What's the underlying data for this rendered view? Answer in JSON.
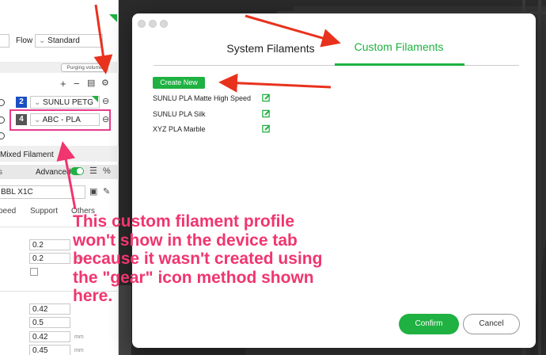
{
  "left_panel": {
    "flow_label": "Flow",
    "flow_value": "Standard",
    "purging_button": "Purging volume",
    "filaments": [
      {
        "index": "2",
        "name": "SUNLU PETG",
        "swatch": "#1a4fc4"
      },
      {
        "index": "4",
        "name": "ABC - PLA",
        "swatch": "#555555"
      }
    ],
    "mixed_filament": "Mixed Filament",
    "advanced_label": "Advanced",
    "printer_name": "BBL X1C",
    "column_tabs": [
      "peed",
      "Support",
      "Others"
    ],
    "values_group1": [
      "0.2",
      "0.2"
    ],
    "values_group2": [
      "0.42",
      "0.5",
      "0.42",
      "0.45"
    ],
    "unit_mm": "mm"
  },
  "dialog": {
    "tabs": [
      {
        "label": "System Filaments",
        "active": false
      },
      {
        "label": "Custom Filaments",
        "active": true
      }
    ],
    "create_button": "Create New",
    "custom_filaments": [
      "SUNLU PLA Matte High Speed",
      "SUNLU PLA Silk",
      "XYZ PLA Marble"
    ],
    "confirm_button": "Confirm",
    "cancel_button": "Cancel"
  },
  "annotation": {
    "text": "This custom filament profile won't show in the device tab because it wasn't created using the \"gear\" icon method shown here."
  },
  "colors": {
    "accent_green": "#1fb141",
    "annotation_pink": "#f0356f",
    "arrow_red": "#e8321e"
  }
}
